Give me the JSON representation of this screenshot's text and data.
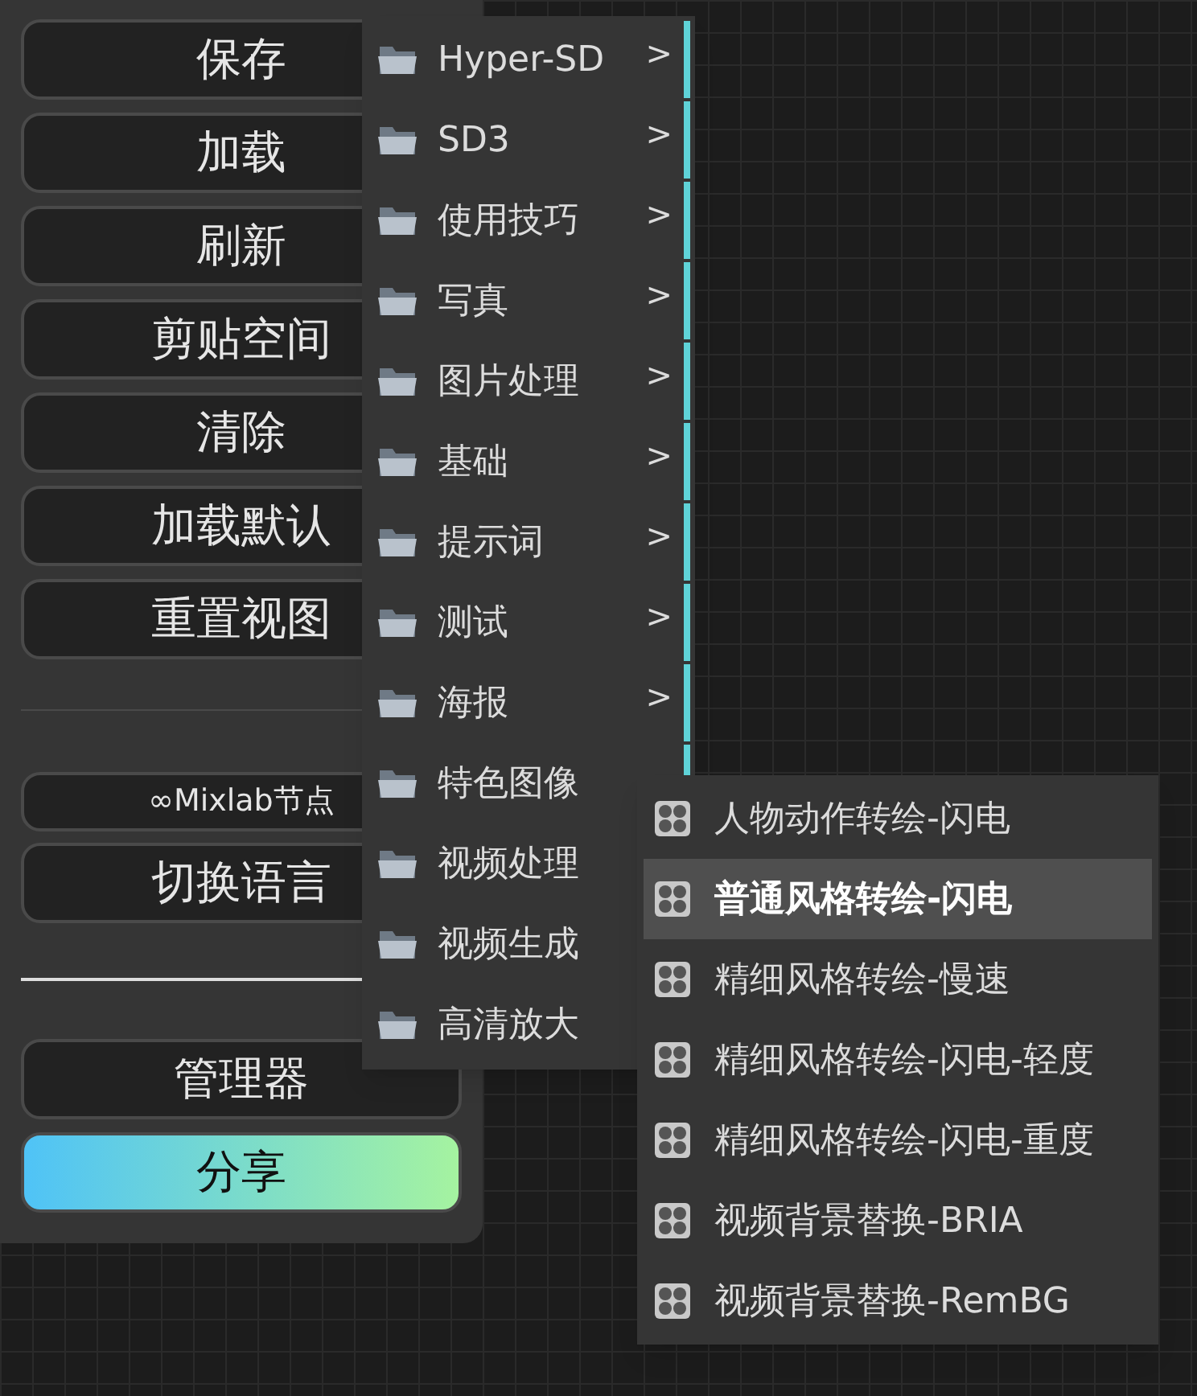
{
  "sidebar": {
    "buttons": [
      {
        "label": "保存"
      },
      {
        "label": "加载"
      },
      {
        "label": "刷新"
      },
      {
        "label": "剪贴空间"
      },
      {
        "label": "清除"
      },
      {
        "label": "加载默认"
      },
      {
        "label": "重置视图"
      }
    ],
    "mixlab_button": {
      "label": "∞Mixlab节点"
    },
    "language_button": {
      "label": "切换语言"
    },
    "manager_button": {
      "label": "管理器"
    },
    "share_button": {
      "label": "分享"
    }
  },
  "menu": {
    "items": [
      {
        "label": "Hyper-SD",
        "chevron": ">",
        "has_submenu": true
      },
      {
        "label": "SD3",
        "chevron": ">",
        "has_submenu": true
      },
      {
        "label": "使用技巧",
        "chevron": ">",
        "has_submenu": true
      },
      {
        "label": "写真",
        "chevron": ">",
        "has_submenu": true
      },
      {
        "label": "图片处理",
        "chevron": ">",
        "has_submenu": true
      },
      {
        "label": "基础",
        "chevron": ">",
        "has_submenu": true
      },
      {
        "label": "提示词",
        "chevron": ">",
        "has_submenu": true
      },
      {
        "label": "测试",
        "chevron": ">",
        "has_submenu": true
      },
      {
        "label": "海报",
        "chevron": ">",
        "has_submenu": true
      },
      {
        "label": "特色图像",
        "has_submenu": true
      },
      {
        "label": "视频处理"
      },
      {
        "label": "视频生成"
      },
      {
        "label": "高清放大"
      }
    ]
  },
  "submenu": {
    "items": [
      {
        "label": "人物动作转绘-闪电",
        "selected": false
      },
      {
        "label": "普通风格转绘-闪电",
        "selected": true
      },
      {
        "label": "精细风格转绘-慢速",
        "selected": false
      },
      {
        "label": "精细风格转绘-闪电-轻度",
        "selected": false
      },
      {
        "label": "精细风格转绘-闪电-重度",
        "selected": false
      },
      {
        "label": "视频背景替换-BRIA",
        "selected": false
      },
      {
        "label": "视频背景替换-RemBG",
        "selected": false
      }
    ]
  }
}
